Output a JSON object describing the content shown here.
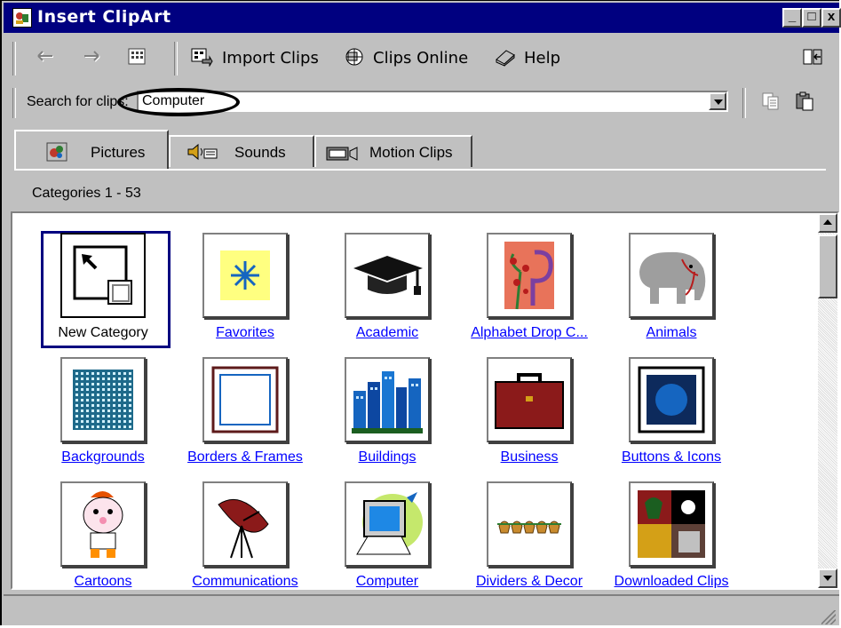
{
  "window": {
    "title": "Insert ClipArt",
    "controls": {
      "minimize": "_",
      "maximize": "□",
      "close": "x"
    }
  },
  "toolbar": {
    "back": "back-arrow-icon",
    "forward": "forward-arrow-icon",
    "import_clips": "Import Clips",
    "clips_online": "Clips Online",
    "help": "Help"
  },
  "search": {
    "label": "Search for clips:",
    "value": "Computer"
  },
  "tabs": [
    {
      "label": "Pictures",
      "icon": "pictures-icon",
      "active": true
    },
    {
      "label": "Sounds",
      "icon": "sounds-icon",
      "active": false
    },
    {
      "label": "Motion Clips",
      "icon": "motion-clips-icon",
      "active": false
    }
  ],
  "categories_label": "Categories 1 - 53",
  "categories": [
    {
      "label": "New Category",
      "icon": "new-category-icon",
      "selected": true
    },
    {
      "label": "Favorites",
      "icon": "favorites-icon"
    },
    {
      "label": "Academic",
      "icon": "graduation-cap-icon"
    },
    {
      "label": "Alphabet Drop C...",
      "icon": "alphabet-drop-cap-icon"
    },
    {
      "label": "Animals",
      "icon": "elephant-icon"
    },
    {
      "label": "Backgrounds",
      "icon": "backgrounds-icon"
    },
    {
      "label": "Borders & Frames",
      "icon": "frame-icon"
    },
    {
      "label": "Buildings",
      "icon": "buildings-icon"
    },
    {
      "label": "Business",
      "icon": "briefcase-icon"
    },
    {
      "label": "Buttons & Icons",
      "icon": "button-icon"
    },
    {
      "label": "Cartoons",
      "icon": "cartoon-kid-icon"
    },
    {
      "label": "Communications",
      "icon": "satellite-dish-icon"
    },
    {
      "label": "Computer",
      "icon": "computer-icon"
    },
    {
      "label": "Dividers & Decor",
      "icon": "divider-icon"
    },
    {
      "label": "Downloaded Clips",
      "icon": "downloaded-clips-icon"
    }
  ],
  "colors": {
    "titlebar": "#000080",
    "face": "#c0c0c0",
    "link": "#0000ff"
  }
}
